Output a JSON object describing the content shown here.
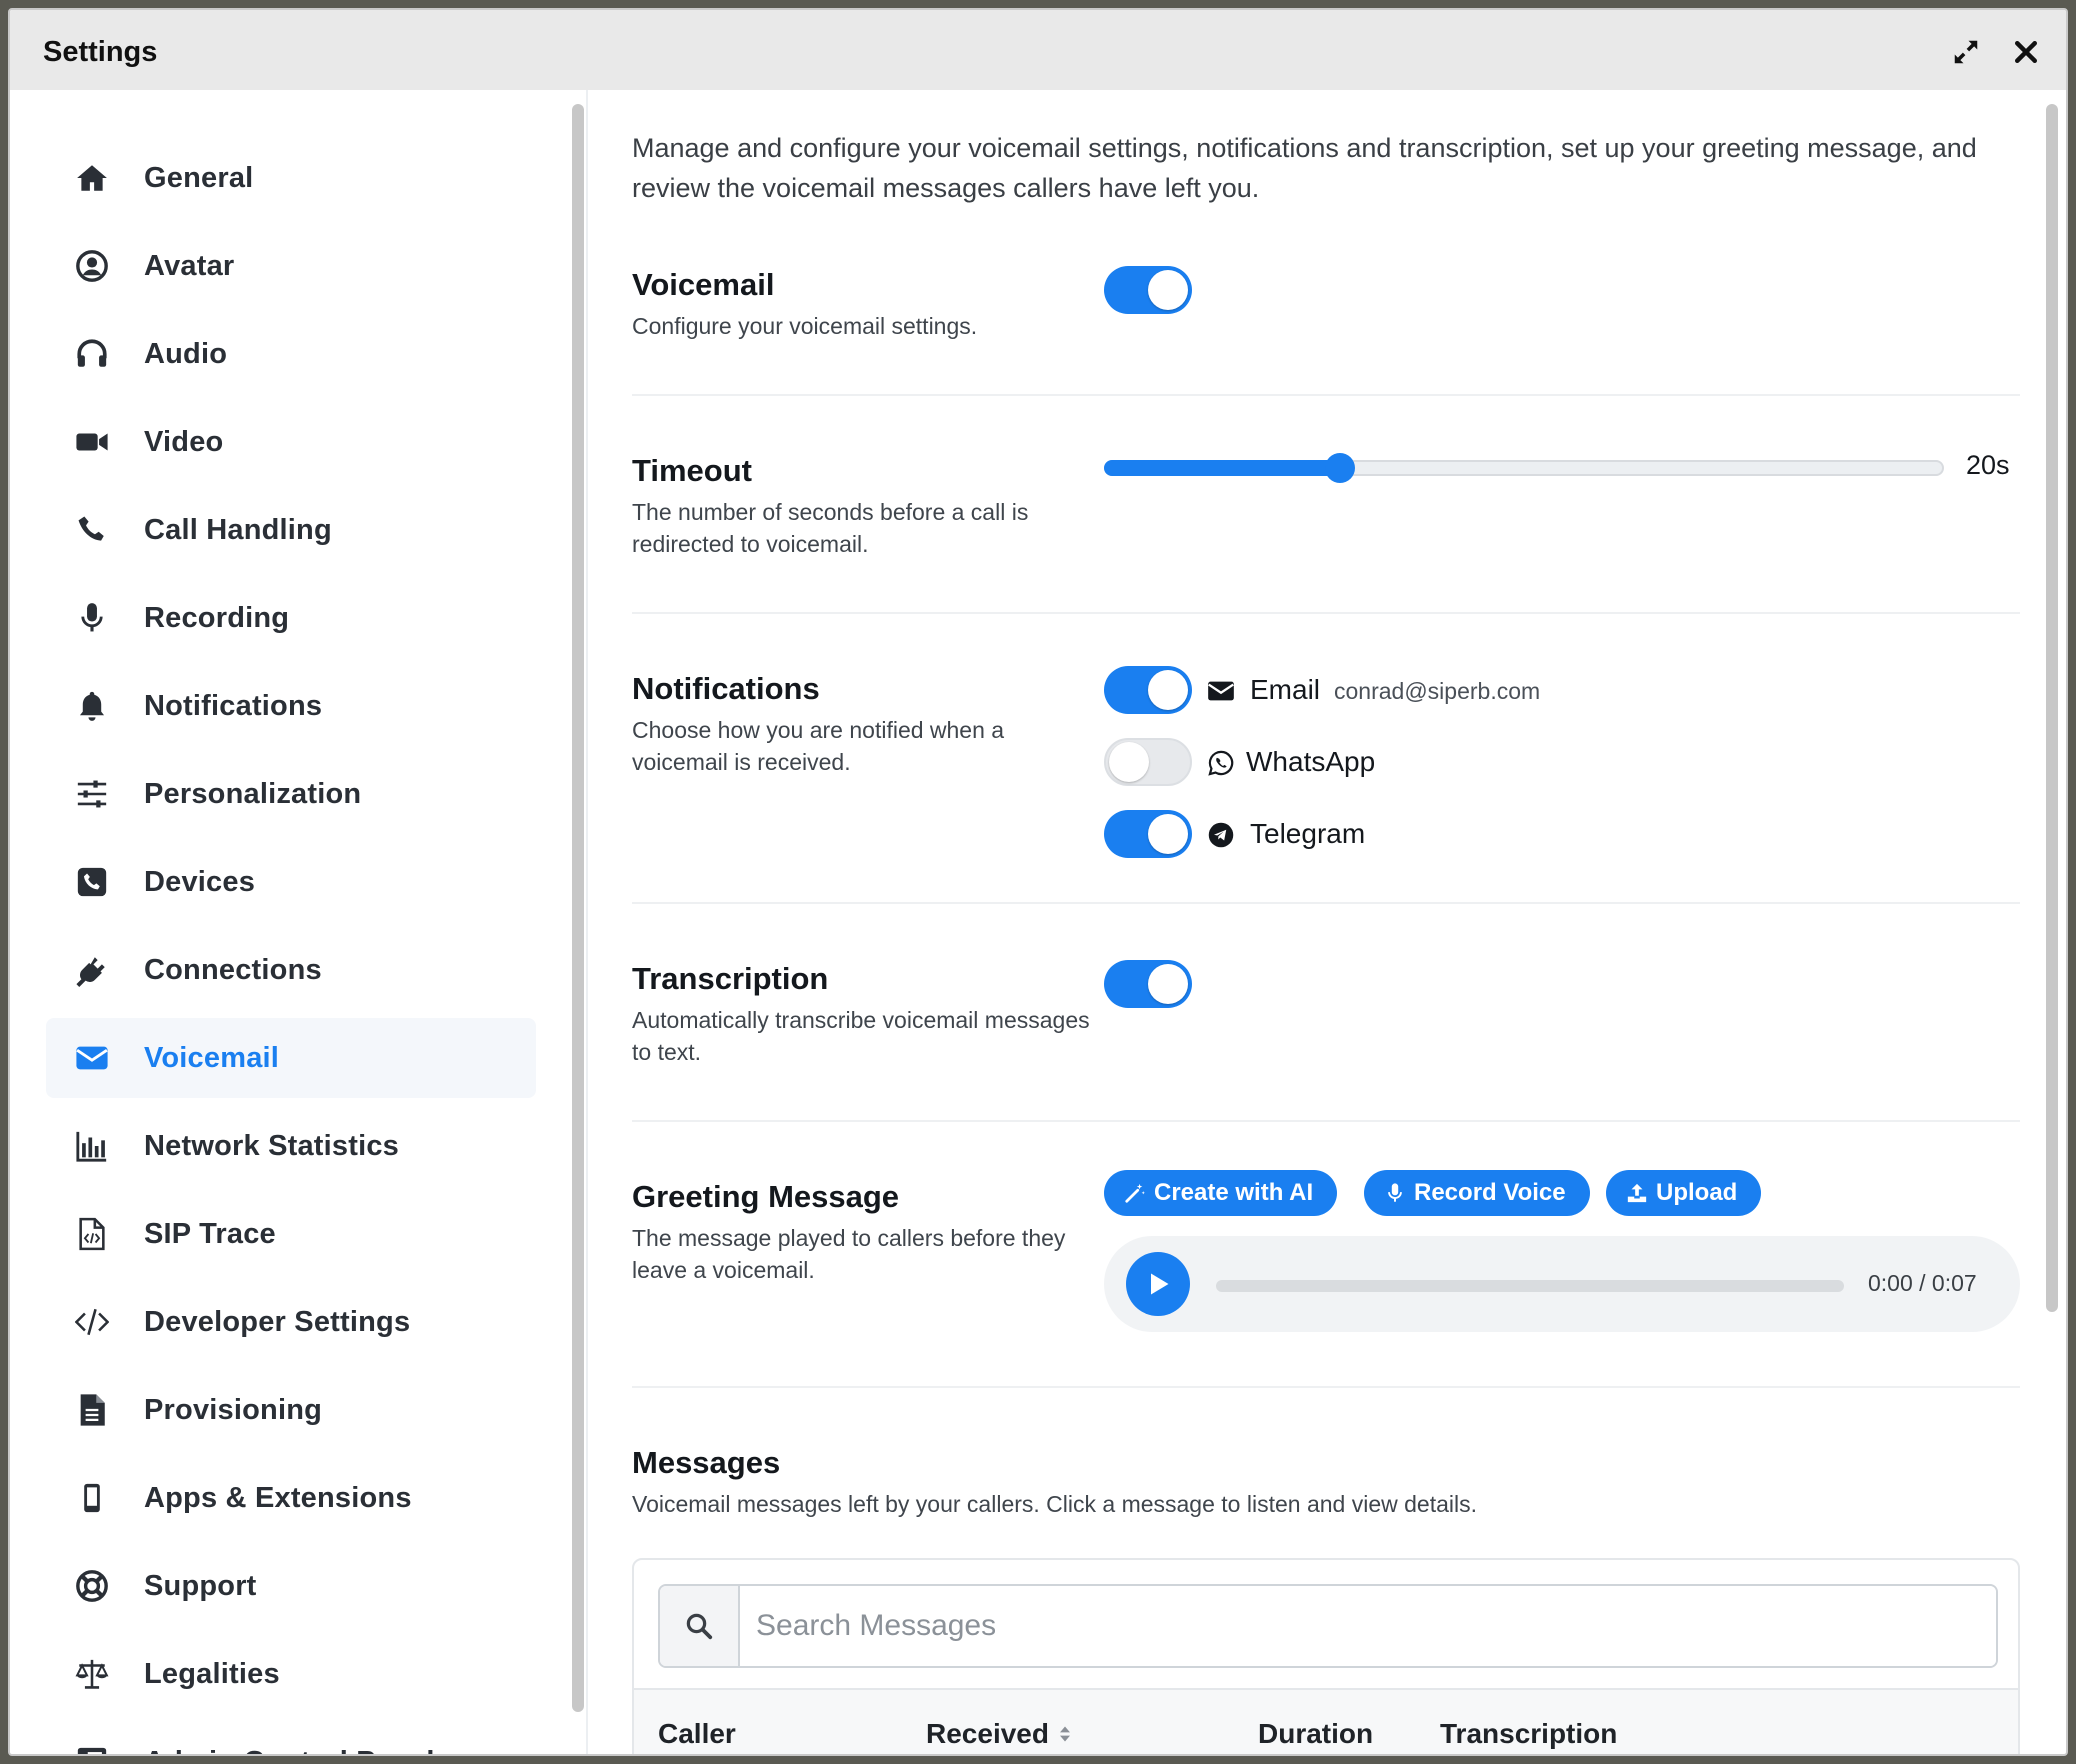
{
  "window": {
    "title": "Settings"
  },
  "sidebar": {
    "items": [
      {
        "label": "General",
        "icon": "home-icon"
      },
      {
        "label": "Avatar",
        "icon": "user-circle-icon"
      },
      {
        "label": "Audio",
        "icon": "headphones-icon"
      },
      {
        "label": "Video",
        "icon": "video-camera-icon"
      },
      {
        "label": "Call Handling",
        "icon": "phone-icon"
      },
      {
        "label": "Recording",
        "icon": "microphone-icon"
      },
      {
        "label": "Notifications",
        "icon": "bell-icon"
      },
      {
        "label": "Personalization",
        "icon": "sliders-icon"
      },
      {
        "label": "Devices",
        "icon": "phone-square-icon"
      },
      {
        "label": "Connections",
        "icon": "plug-icon"
      },
      {
        "label": "Voicemail",
        "icon": "envelope-icon",
        "active": true
      },
      {
        "label": "Network Statistics",
        "icon": "bar-chart-icon"
      },
      {
        "label": "SIP Trace",
        "icon": "code-file-icon"
      },
      {
        "label": "Developer Settings",
        "icon": "code-icon"
      },
      {
        "label": "Provisioning",
        "icon": "document-icon"
      },
      {
        "label": "Apps & Extensions",
        "icon": "mobile-icon"
      },
      {
        "label": "Support",
        "icon": "lifebuoy-icon"
      },
      {
        "label": "Legalities",
        "icon": "scale-icon"
      },
      {
        "label": "Admin Control Panel",
        "icon": "admin-icon"
      }
    ]
  },
  "content": {
    "intro": "Manage and configure your voicemail settings, notifications and transcription, set up your greeting message, and review the voicemail messages callers have left you.",
    "voicemail": {
      "title": "Voicemail",
      "desc": "Configure your voicemail settings.",
      "enabled": true
    },
    "timeout": {
      "title": "Timeout",
      "desc": "The number of seconds before a call is redirected to voicemail.",
      "value_label": "20s",
      "fill_fraction": 0.28
    },
    "notifications": {
      "title": "Notifications",
      "desc": "Choose how you are notified when a voicemail is received.",
      "email": {
        "label": "Email",
        "address": "conrad@siperb.com",
        "enabled": true
      },
      "whatsapp": {
        "label": "WhatsApp",
        "enabled": false
      },
      "telegram": {
        "label": "Telegram",
        "enabled": true
      }
    },
    "transcription": {
      "title": "Transcription",
      "desc": "Automatically transcribe voicemail messages to text.",
      "enabled": true
    },
    "greeting": {
      "title": "Greeting Message",
      "desc": "The message played to callers before they leave a voicemail.",
      "create_ai_label": "Create with AI",
      "record_label": "Record Voice",
      "upload_label": "Upload",
      "time": "0:00 / 0:07"
    },
    "messages": {
      "title": "Messages",
      "desc": "Voicemail messages left by your callers. Click a message to listen and view details.",
      "search_placeholder": "Search Messages",
      "columns": {
        "caller": "Caller",
        "received": "Received",
        "duration": "Duration",
        "transcription": "Transcription"
      }
    }
  },
  "colors": {
    "accent": "#1a7ff0",
    "toggle_off": "#e7e9ec"
  }
}
